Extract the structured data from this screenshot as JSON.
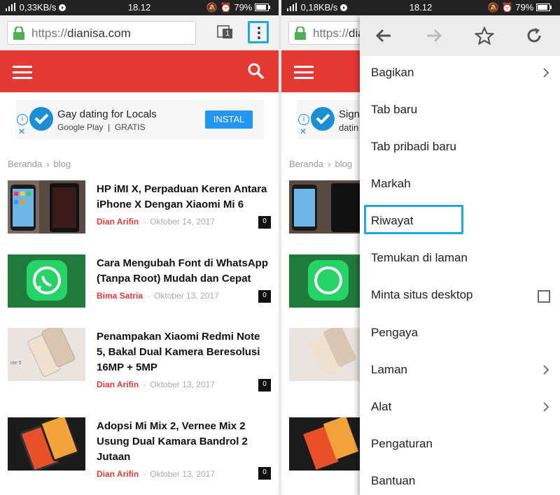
{
  "status_left": {
    "speed": "0,33KB/s",
    "time": "18.12",
    "battery": "79%"
  },
  "status_right": {
    "speed": "0,18KB/s",
    "time": "18.12",
    "battery": "79%"
  },
  "url": {
    "scheme": "https://",
    "host": "dianisa.com"
  },
  "tab_count": "1",
  "ad": {
    "title": "Gay dating for Locals",
    "store": "Google Play",
    "price": "GRATIS",
    "install": "INSTAL",
    "title_partial_1": "Sign",
    "title_partial_2": "datin"
  },
  "breadcrumb": {
    "home": "Beranda",
    "separator": "›",
    "current": "blog"
  },
  "posts": [
    {
      "title": "HP iMI X, Perpaduan Keren Antara iPhone X Dengan Xiaomi Mi 6",
      "author": "Dian Arifin",
      "date": "Oktober 14, 2017",
      "comments": "0"
    },
    {
      "title": "Cara Mengubah Font di WhatsApp (Tanpa Root) Mudah dan Cepat",
      "author": "Bima Satria",
      "date": "Oktober 13, 2017",
      "comments": "0"
    },
    {
      "title": "Penampakan Xiaomi Redmi Note 5, Bakal Dual Kamera Beresolusi 16MP + 5MP",
      "author": "Dian Arifin",
      "date": "Oktober 13, 2017",
      "comments": "0"
    },
    {
      "title": "Adopsi Mi Mix 2, Vernee Mix 2 Usung Dual Kamara Bandrol 2 Jutaan",
      "author": "Dian Arifin",
      "date": "Oktober 13, 2017",
      "comments": "0"
    }
  ],
  "menu": {
    "items": [
      "Bagikan",
      "Tab baru",
      "Tab pribadi baru",
      "Markah",
      "Riwayat",
      "Temukan di laman",
      "Minta situs desktop",
      "Pengaya",
      "Laman",
      "Alat",
      "Pengaturan",
      "Bantuan"
    ],
    "highlighted": "Riwayat"
  },
  "colors": {
    "brand_red": "#e53935",
    "highlight_blue": "#1ea7e1",
    "install_blue": "#2196f3"
  }
}
